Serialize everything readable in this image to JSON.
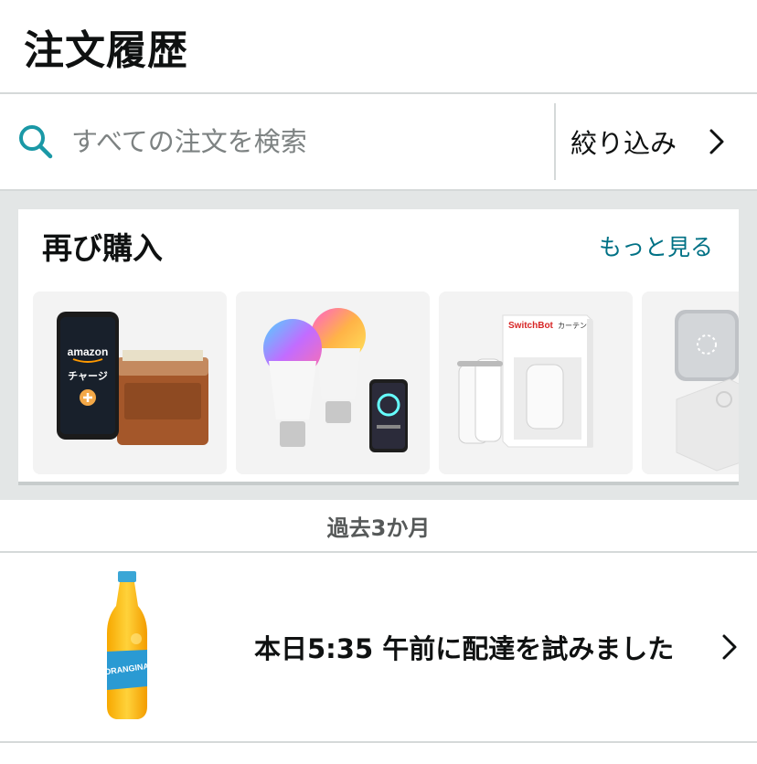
{
  "header": {
    "title": "注文履歴"
  },
  "search": {
    "placeholder": "すべての注文を検索",
    "icon": "search-icon"
  },
  "filter": {
    "label": "絞り込み",
    "icon": "chevron-right-icon"
  },
  "buy_again": {
    "title": "再び購入",
    "see_more": "もっと見る",
    "items": [
      {
        "icon": "amazon-gift-charge-image",
        "brand_text": "amazon",
        "label": "チャージ"
      },
      {
        "icon": "smart-bulb-image",
        "label": ""
      },
      {
        "icon": "switchbot-curtain-image",
        "brand_text": "SwitchBot",
        "label": "カーテン"
      },
      {
        "icon": "smart-hub-image",
        "label": ""
      }
    ]
  },
  "period": {
    "label": "過去3か月"
  },
  "orders": [
    {
      "status": "本日5:35 午前に配達を試みました",
      "icon": "orangina-bottle-image",
      "product_text": "ORANGINA"
    }
  ],
  "colors": {
    "accent": "#007185",
    "search_icon": "#1a98a6",
    "divider": "#d5d9d9",
    "band": "#e3e6e6"
  }
}
